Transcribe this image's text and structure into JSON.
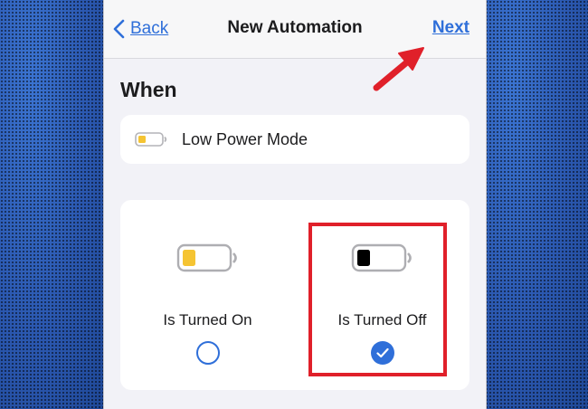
{
  "navbar": {
    "back_label": "Back",
    "title": "New Automation",
    "next_label": "Next"
  },
  "section": {
    "header": "When"
  },
  "trigger": {
    "label": "Low Power Mode",
    "icon": "battery-low-power-icon"
  },
  "options": [
    {
      "label": "Is Turned On",
      "icon": "battery-yellow-icon",
      "selected": false
    },
    {
      "label": "Is Turned Off",
      "icon": "battery-black-icon",
      "selected": true
    }
  ],
  "colors": {
    "accent": "#2f6fd9",
    "low_power_yellow": "#f5c433",
    "annotation_red": "#e0202a",
    "background_blue": "#2f5fb8"
  }
}
